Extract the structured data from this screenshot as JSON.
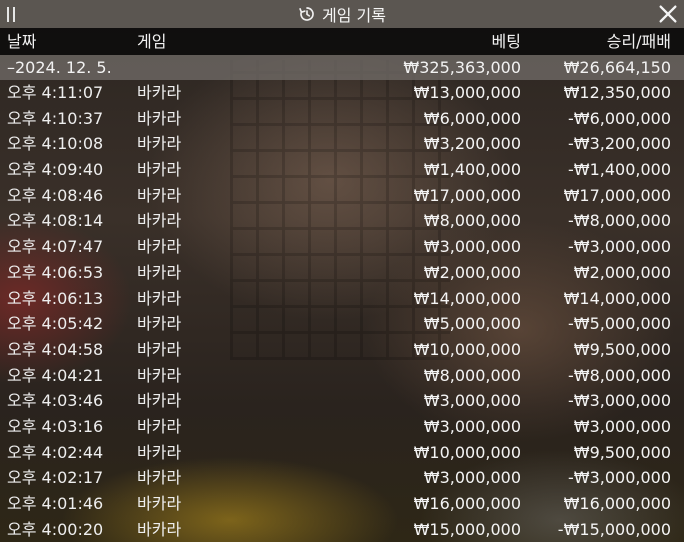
{
  "window": {
    "title": "게임 기록",
    "history_icon": "history-icon",
    "drag_icon": "drag-handle-icon",
    "close_icon": "close-icon"
  },
  "columns": {
    "date": "날짜",
    "game": "게임",
    "bet": "베팅",
    "result": "승리/패배"
  },
  "summary": {
    "date": "–2024. 12. 5.",
    "bet": "₩325,363,000",
    "result": "₩26,664,150"
  },
  "rows": [
    {
      "time": "오후 4:11:07",
      "game": "바카라",
      "bet": "₩13,000,000",
      "result": "₩12,350,000"
    },
    {
      "time": "오후 4:10:37",
      "game": "바카라",
      "bet": "₩6,000,000",
      "result": "-₩6,000,000"
    },
    {
      "time": "오후 4:10:08",
      "game": "바카라",
      "bet": "₩3,200,000",
      "result": "-₩3,200,000"
    },
    {
      "time": "오후 4:09:40",
      "game": "바카라",
      "bet": "₩1,400,000",
      "result": "-₩1,400,000"
    },
    {
      "time": "오후 4:08:46",
      "game": "바카라",
      "bet": "₩17,000,000",
      "result": "₩17,000,000"
    },
    {
      "time": "오후 4:08:14",
      "game": "바카라",
      "bet": "₩8,000,000",
      "result": "-₩8,000,000"
    },
    {
      "time": "오후 4:07:47",
      "game": "바카라",
      "bet": "₩3,000,000",
      "result": "-₩3,000,000"
    },
    {
      "time": "오후 4:06:53",
      "game": "바카라",
      "bet": "₩2,000,000",
      "result": "₩2,000,000"
    },
    {
      "time": "오후 4:06:13",
      "game": "바카라",
      "bet": "₩14,000,000",
      "result": "₩14,000,000"
    },
    {
      "time": "오후 4:05:42",
      "game": "바카라",
      "bet": "₩5,000,000",
      "result": "-₩5,000,000"
    },
    {
      "time": "오후 4:04:58",
      "game": "바카라",
      "bet": "₩10,000,000",
      "result": "₩9,500,000"
    },
    {
      "time": "오후 4:04:21",
      "game": "바카라",
      "bet": "₩8,000,000",
      "result": "-₩8,000,000"
    },
    {
      "time": "오후 4:03:46",
      "game": "바카라",
      "bet": "₩3,000,000",
      "result": "-₩3,000,000"
    },
    {
      "time": "오후 4:03:16",
      "game": "바카라",
      "bet": "₩3,000,000",
      "result": "₩3,000,000"
    },
    {
      "time": "오후 4:02:44",
      "game": "바카라",
      "bet": "₩10,000,000",
      "result": "₩9,500,000"
    },
    {
      "time": "오후 4:02:17",
      "game": "바카라",
      "bet": "₩3,000,000",
      "result": "-₩3,000,000"
    },
    {
      "time": "오후 4:01:46",
      "game": "바카라",
      "bet": "₩16,000,000",
      "result": "₩16,000,000"
    },
    {
      "time": "오후 4:00:20",
      "game": "바카라",
      "bet": "₩15,000,000",
      "result": "-₩15,000,000"
    }
  ]
}
